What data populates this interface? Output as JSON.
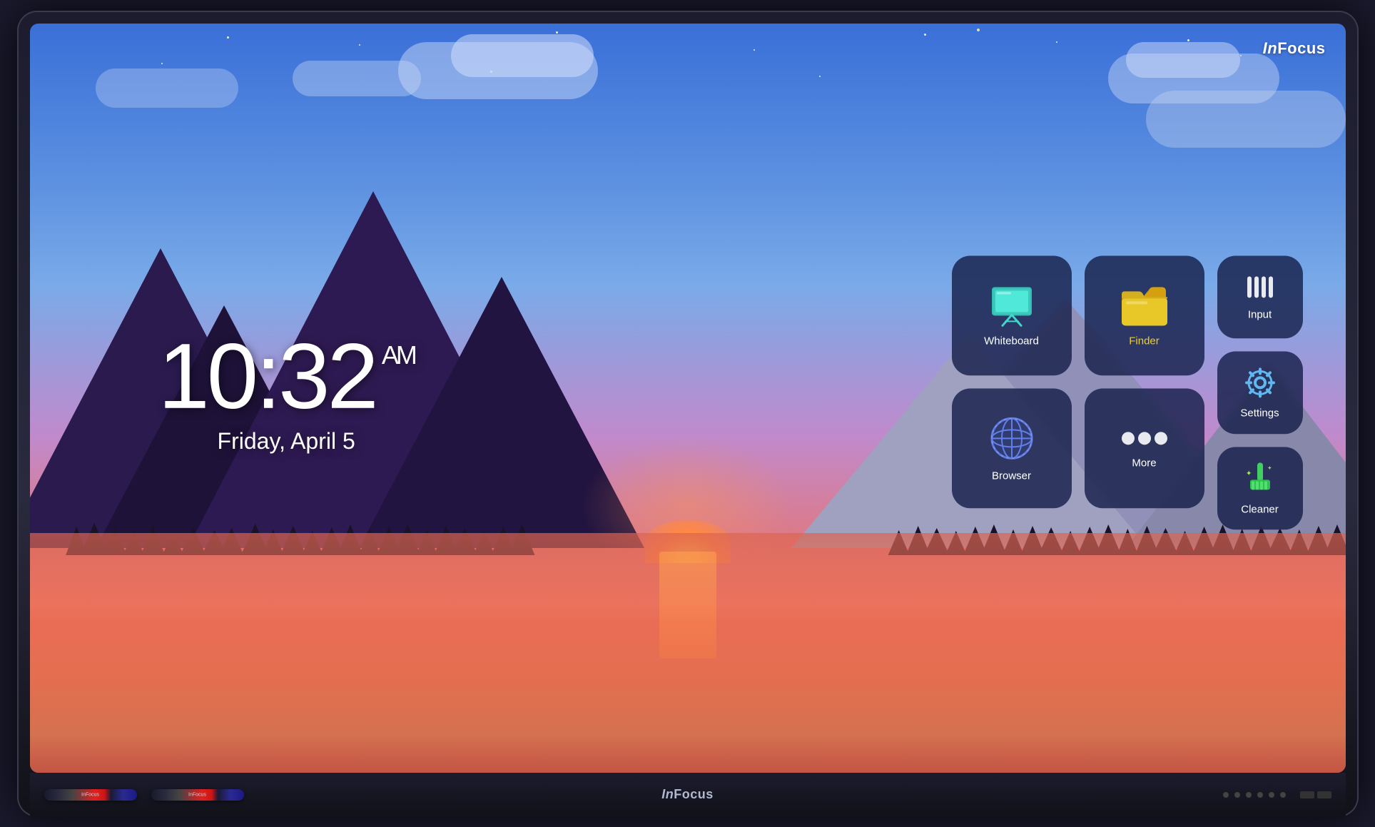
{
  "brand": {
    "name_italic": "In",
    "name_rest": "Focus",
    "full": "InFocus"
  },
  "clock": {
    "time": "10:32",
    "period": "AM",
    "date": "Friday, April 5"
  },
  "apps": {
    "whiteboard": {
      "label": "Whiteboard",
      "label_color": "white"
    },
    "finder": {
      "label": "Finder",
      "label_color": "yellow"
    },
    "input": {
      "label": "Input",
      "label_color": "white"
    },
    "browser": {
      "label": "Browser",
      "label_color": "white"
    },
    "more": {
      "label": "More",
      "label_color": "white"
    },
    "settings": {
      "label": "Settings",
      "label_color": "white"
    },
    "cleaner": {
      "label": "Cleaner",
      "label_color": "white"
    }
  },
  "bezel": {
    "logo": "InFocus",
    "stylus1_label": "InFocus",
    "stylus2_label": "InFocus"
  }
}
